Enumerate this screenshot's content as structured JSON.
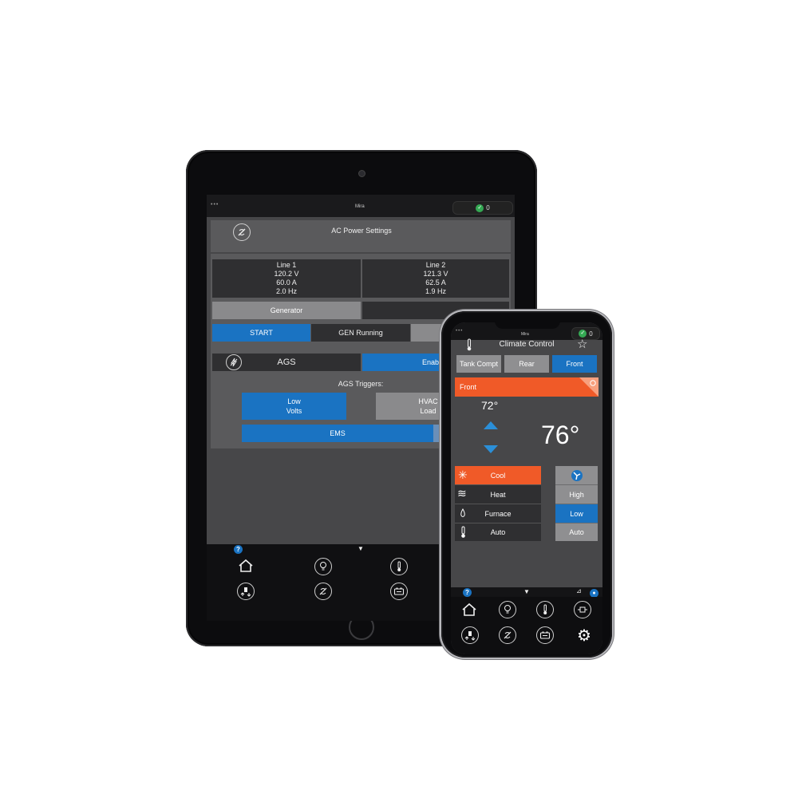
{
  "tablet": {
    "status": {
      "dots": "•••",
      "title": "Mira",
      "count": "0"
    },
    "header": {
      "title": "AC Power Settings"
    },
    "lines": [
      {
        "name": "Line 1",
        "voltage": "120.2 V",
        "current": "60.0 A",
        "freq": "2.0 Hz"
      },
      {
        "name": "Line 2",
        "voltage": "121.3 V",
        "current": "62.5 A",
        "freq": "1.9 Hz"
      }
    ],
    "generator_label": "Generator",
    "start_label": "START",
    "gen_status": "GEN Running",
    "ags": {
      "label": "AGS",
      "state": "Enabl"
    },
    "triggers": {
      "title": "AGS Triggers:",
      "low_volts": [
        "Low",
        "Volts"
      ],
      "hvac": [
        "HVAC",
        "Load"
      ],
      "ems": "EMS"
    },
    "help_badge": "?",
    "chevron": "▼",
    "nav_icons": [
      "home-icon",
      "lightbulb-icon",
      "thermometer-icon",
      "generator-icon",
      "ac-power-icon",
      "battery-icon"
    ]
  },
  "phone": {
    "status": {
      "dots": "•••",
      "title": "Mira",
      "count": "0"
    },
    "header": {
      "title": "Climate Control",
      "star": "☆"
    },
    "zones": [
      "Tank Compt",
      "Rear",
      "Front"
    ],
    "selected_zone": "Front",
    "zone_banner": "Front",
    "setpoint": "72°",
    "current_temp": "76°",
    "modes": [
      "Cool",
      "Heat",
      "Furnace",
      "Auto"
    ],
    "selected_mode": "Cool",
    "fan": [
      "High",
      "Low",
      "Auto"
    ],
    "selected_fan": "Low",
    "help_badge": "?",
    "chevron": "▼",
    "nav_icons": [
      "home-icon",
      "lightbulb-icon",
      "thermometer-icon",
      "inverter-icon",
      "generator-icon",
      "ac-power-icon",
      "battery-icon",
      "gear-icon"
    ]
  },
  "colors": {
    "accent_blue": "#1a73c2",
    "accent_orange": "#f05a28",
    "ok_green": "#34a853"
  }
}
